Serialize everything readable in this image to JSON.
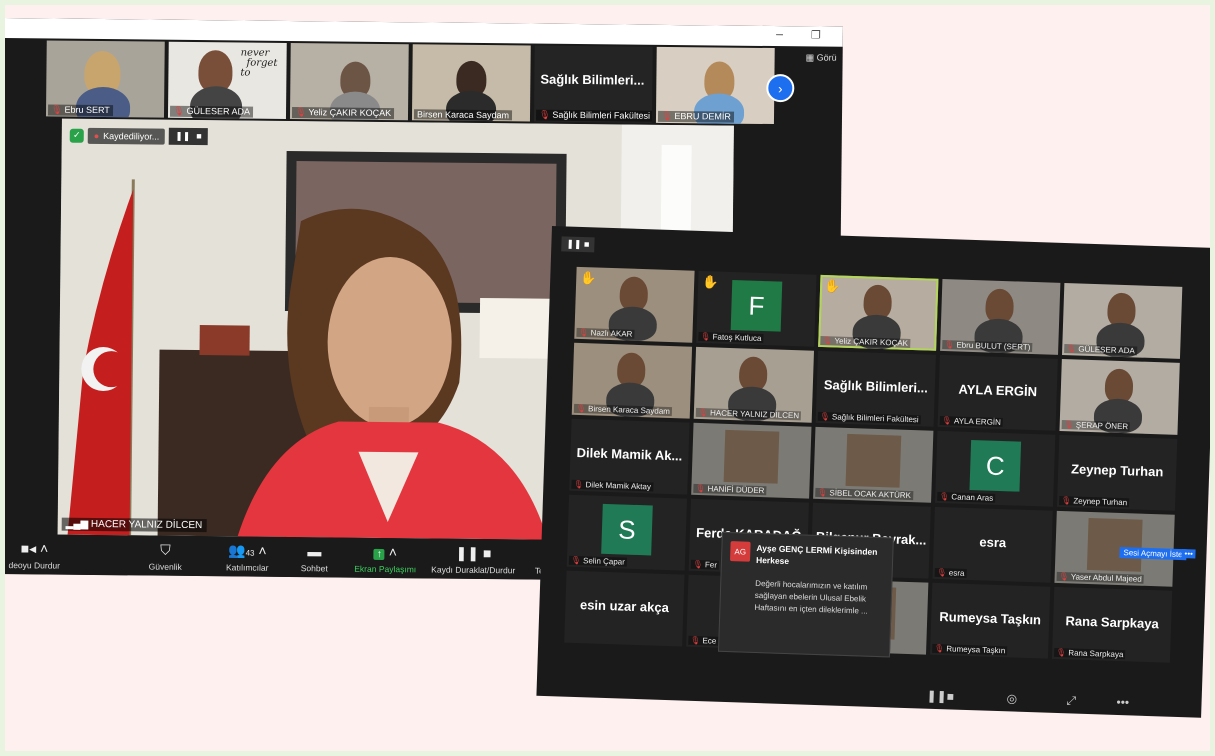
{
  "window1": {
    "titlebar": {
      "minimize": "−",
      "restore": "❐"
    },
    "gallery_label": "Görü",
    "thumbnails": [
      {
        "name": "Ebru SERT",
        "kind": "video"
      },
      {
        "name": "GÜLESER ADA",
        "kind": "video",
        "poster_line1": "never",
        "poster_line2": "forget",
        "poster_line3": "to"
      },
      {
        "name": "Yeliz ÇAKIR KOÇAK",
        "kind": "video"
      },
      {
        "name": "Birsen Karaca Saydam",
        "kind": "video"
      },
      {
        "name": "Sağlık Bilimleri Fakültesi",
        "kind": "text",
        "display": "Sağlık Bilimleri..."
      },
      {
        "name": "EBRU DEMİR",
        "kind": "video"
      }
    ],
    "recording": {
      "label": "Kaydediliyor...",
      "pause": "❚❚",
      "stop": "■"
    },
    "speaker_name": "HACER YALNIZ DİLCEN",
    "toolbar": [
      {
        "label": "deoyu Durdur",
        "icon": "video-icon"
      },
      {
        "label": "Güvenlik",
        "icon": "shield-icon"
      },
      {
        "label": "Katılımcılar",
        "icon": "participants-icon",
        "count": "43"
      },
      {
        "label": "Sohbet",
        "icon": "chat-icon"
      },
      {
        "label": "Ekran Paylaşımı",
        "icon": "share-icon"
      },
      {
        "label": "Kaydı Duraklat/Durdur",
        "icon": "record-icon"
      },
      {
        "label": "Te",
        "icon": ""
      }
    ]
  },
  "window2": {
    "pause_label": "❚❚ ■",
    "tiles": [
      {
        "name": "Nazlı AKAR",
        "kind": "video",
        "hand": true
      },
      {
        "name": "Fatoş Kutluca",
        "kind": "letter",
        "letter": "F",
        "color": "#1f7a45",
        "hand": true
      },
      {
        "name": "Yeliz ÇAKIR KOÇAK",
        "kind": "video",
        "active": true,
        "hand": true
      },
      {
        "name": "Ebru BULUT (SERT)",
        "kind": "video"
      },
      {
        "name": "GÜLESER ADA",
        "kind": "video"
      },
      {
        "name": "Birsen Karaca Saydam",
        "kind": "video"
      },
      {
        "name": "HACER YALNIZ DİLCEN",
        "kind": "video"
      },
      {
        "name": "Sağlık Bilimleri Fakültesi",
        "kind": "text",
        "display": "Sağlık Bilimleri..."
      },
      {
        "name": "AYLA ERGİN",
        "kind": "text",
        "display": "AYLA ERGİN"
      },
      {
        "name": "ŞERAP ÖNER",
        "kind": "video"
      },
      {
        "name": "Dilek Mamik Aktay",
        "kind": "text",
        "display": "Dilek Mamik Ak..."
      },
      {
        "name": "HANİFİ DÜDER",
        "kind": "photo"
      },
      {
        "name": "SİBEL OCAK AKTÜRK",
        "kind": "photo"
      },
      {
        "name": "Canan Aras",
        "kind": "letter",
        "letter": "C",
        "color": "#1f7a55"
      },
      {
        "name": "Zeynep Turhan",
        "kind": "text",
        "display": "Zeynep Turhan"
      },
      {
        "name": "Selin Çapar",
        "kind": "letter",
        "letter": "S",
        "color": "#1f7a55"
      },
      {
        "name": "Fer",
        "kind": "text",
        "display": "Ferda KARADAĞ"
      },
      {
        "name": "",
        "kind": "text",
        "display": "Bilgenur Bayrak..."
      },
      {
        "name": "esra",
        "kind": "text",
        "display": "esra"
      },
      {
        "name": "Yaser Abdul Majeed",
        "kind": "photo"
      },
      {
        "name": "",
        "kind": "text",
        "display": "esin uzar akça"
      },
      {
        "name": "Ece",
        "kind": "text",
        "display": "Ece"
      },
      {
        "name": "",
        "kind": "photo"
      },
      {
        "name": "Rumeysa Taşkın",
        "kind": "text",
        "display": "Rumeysa Taşkın"
      },
      {
        "name": "Rana Sarpkaya",
        "kind": "text",
        "display": "Rana Sarpkaya"
      }
    ],
    "chat": {
      "avatar": "AG",
      "from": "Ayşe GENÇ LERMİ Kişisinden Herkese",
      "message": "Değerli hocalarımızın ve katılım sağlayan ebelerin Ulusal Ebelik Haftasını en içten dileklerimle ..."
    },
    "sesi": "Sesi Açmayı İste",
    "sesi_more": "•••",
    "toolbar": [
      "❚❚■",
      "◎",
      "⤢",
      "•••"
    ]
  }
}
